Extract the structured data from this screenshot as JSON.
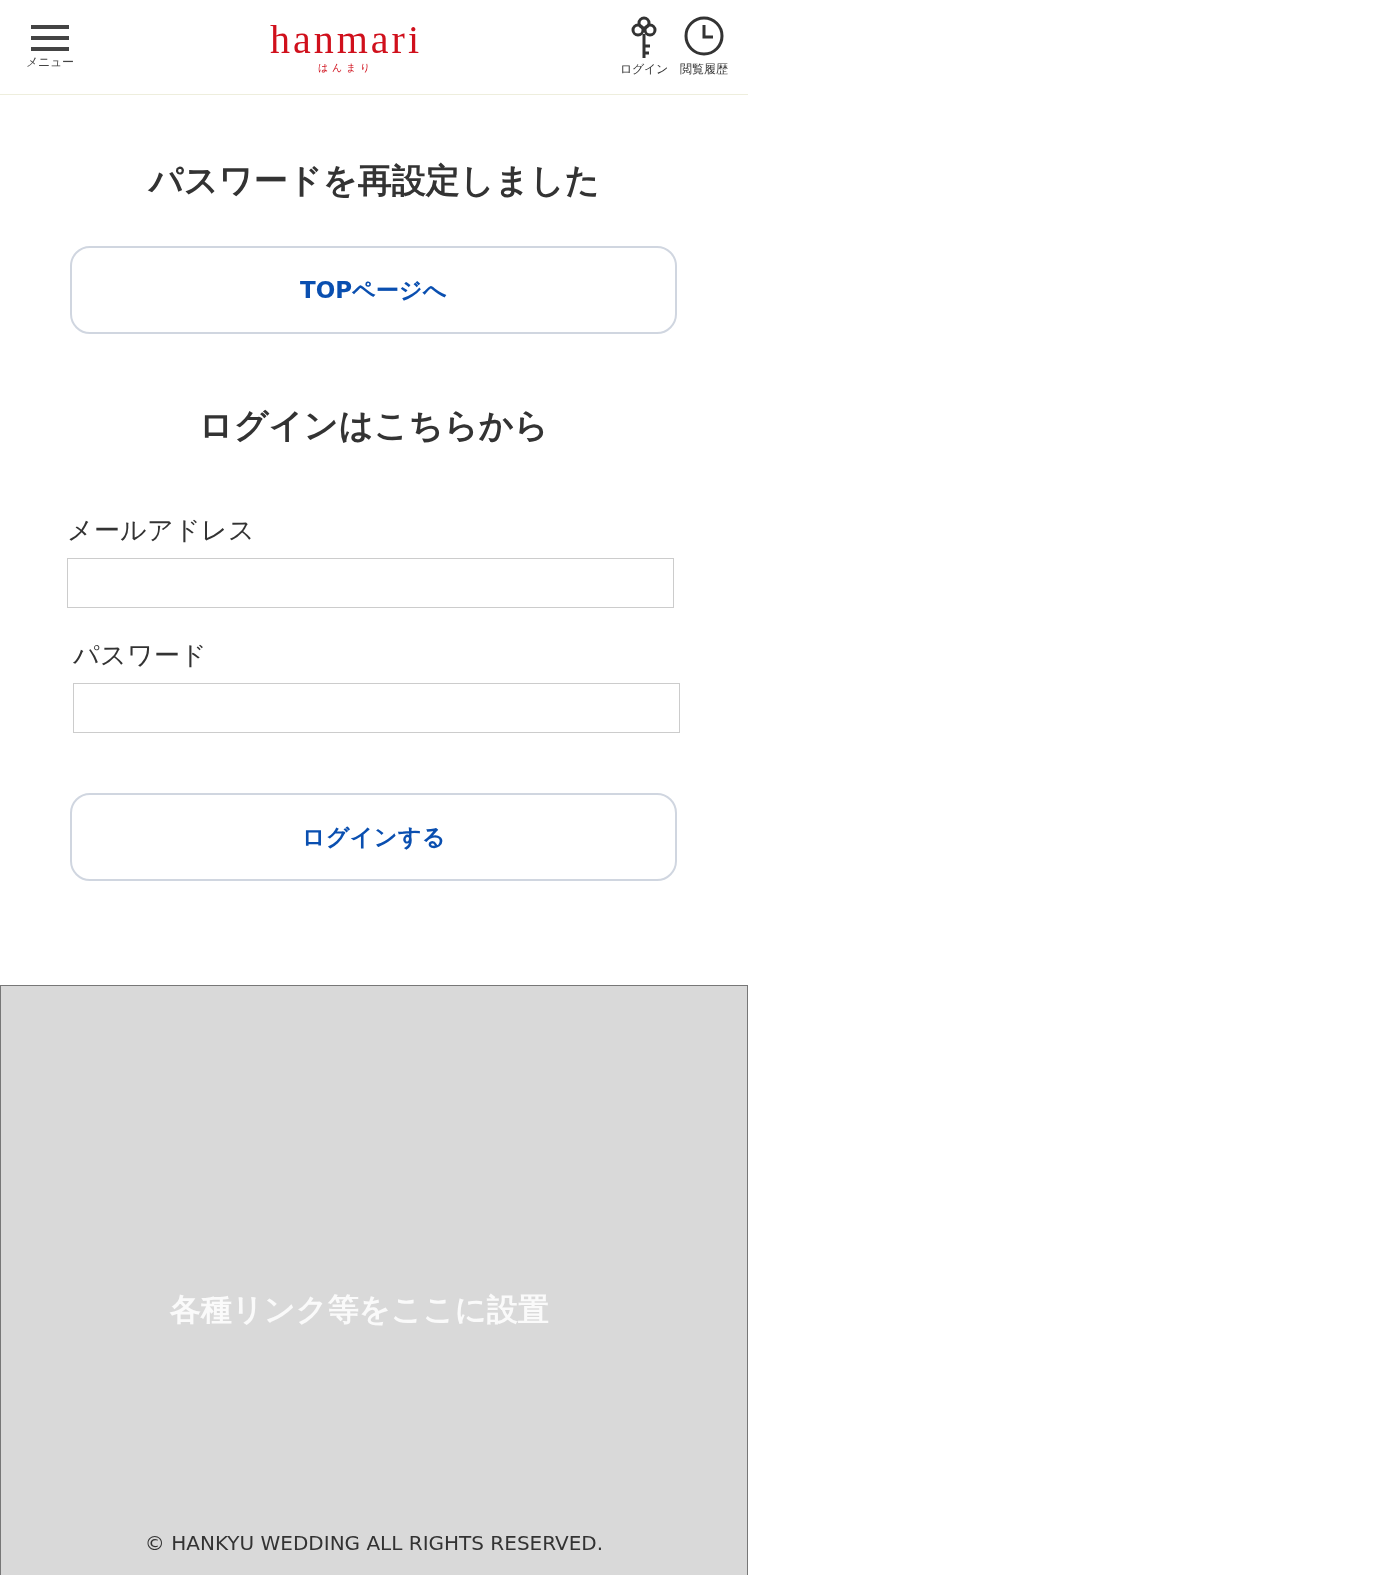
{
  "header": {
    "menu_label": "メニュー",
    "logo": "hanmari",
    "logo_sub": "はんまり",
    "login_label": "ログイン",
    "history_label": "閲覧履歴"
  },
  "title": "パスワードを再設定しました",
  "top_button": "TOPページへ",
  "login_heading": "ログインはこちらから",
  "fields": [
    {
      "label": "メールアドレス"
    },
    {
      "label": "パスワード"
    }
  ],
  "login_button": "ログインする",
  "footer": {
    "links_note": "各種リンク等をここに設置",
    "copyright": "© HANKYU WEDDING ALL RIGHTS RESERVED."
  }
}
